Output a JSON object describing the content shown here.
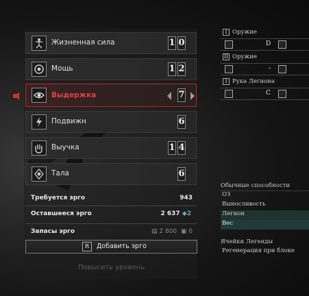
{
  "stats": [
    {
      "label": "Жизненная сила",
      "digits": [
        "1",
        "0"
      ],
      "icon": "vitruvian-icon"
    },
    {
      "label": "Мощь",
      "digits": [
        "1",
        "2"
      ],
      "icon": "target-icon"
    },
    {
      "label": "Выдержка",
      "digits": [
        "7"
      ],
      "icon": "eye-icon",
      "selected": true
    },
    {
      "label": "Подвижн",
      "digits": [
        "6"
      ],
      "icon": "lightning-icon"
    },
    {
      "label": "Выучка",
      "digits": [
        "1",
        "4"
      ],
      "icon": "hand-icon"
    },
    {
      "label": "Тала",
      "digits": [
        "6"
      ],
      "icon": "gem-icon"
    }
  ],
  "required_ergo": {
    "label": "Требуется эрго",
    "value": "943"
  },
  "remaining_ergo": {
    "label": "Оставшееся эрго",
    "value": "2 637",
    "badge": "2"
  },
  "ergo_stock": {
    "label": "Запасы эрго",
    "value1": "2 800",
    "value2": "0"
  },
  "add_ergo": {
    "key": "R",
    "label": "Добавить эрго"
  },
  "level_up": "Повысить уровень",
  "weapons": [
    {
      "roman": "I",
      "title": "Оружие",
      "grade": "D"
    },
    {
      "roman": "II",
      "title": "Оружие",
      "grade": "-"
    },
    {
      "roman": "I",
      "title": "Рука Легиона",
      "grade": "C"
    }
  ],
  "abilities": {
    "header": "Обычные способности",
    "items": [
      "ОЗ",
      "Выносливость",
      "Легион",
      "Вес"
    ]
  },
  "legion": {
    "header": "Ячейки Легенды",
    "items": [
      "Регенерация при блоке"
    ]
  },
  "colors": {
    "accent_red": "#d03030",
    "highlight_teal": "#1f3330"
  }
}
